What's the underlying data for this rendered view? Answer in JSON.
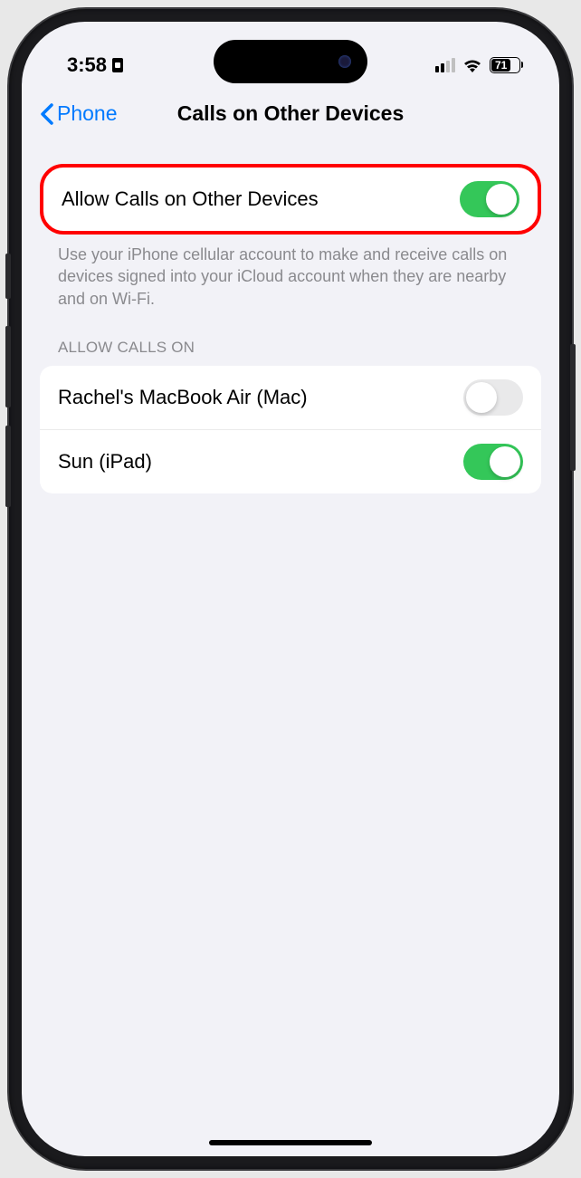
{
  "status": {
    "time": "3:58",
    "battery_pct": "71"
  },
  "nav": {
    "back_label": "Phone",
    "title": "Calls on Other Devices"
  },
  "main_toggle": {
    "label": "Allow Calls on Other Devices",
    "on": true
  },
  "description": "Use your iPhone cellular account to make and receive calls on devices signed into your iCloud account when they are nearby and on Wi-Fi.",
  "section_header": "ALLOW CALLS ON",
  "devices": [
    {
      "label": "Rachel's MacBook Air (Mac)",
      "on": false
    },
    {
      "label": "Sun (iPad)",
      "on": true
    }
  ]
}
